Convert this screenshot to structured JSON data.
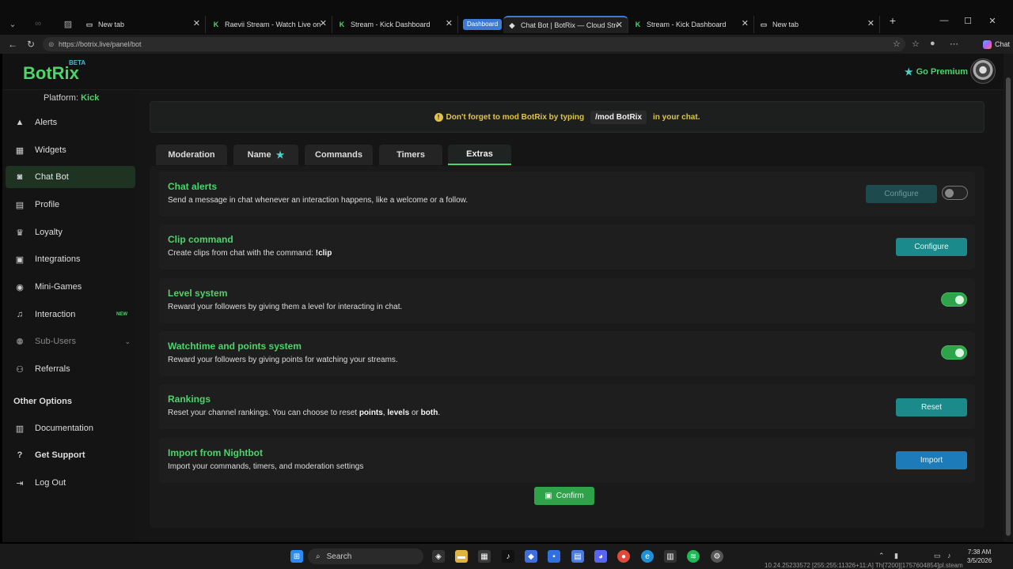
{
  "browser": {
    "tabs": [
      {
        "label": "New tab"
      },
      {
        "label": "Raevii Stream - Watch Live on Kick"
      },
      {
        "label": "Stream - Kick Dashboard"
      },
      {
        "label": "Chat Bot | BotRix — Cloud Streami"
      },
      {
        "label": "Stream - Kick Dashboard"
      },
      {
        "label": "New tab"
      }
    ],
    "group_label": "Dashboard",
    "url": "https://botrix.live/panel/bot",
    "chat_label": "Chat"
  },
  "header": {
    "logo": "BotRix",
    "beta": "BETA",
    "premium": "Go Premium"
  },
  "sidebar": {
    "platform_label": "Platform:",
    "platform_value": "Kick",
    "items": [
      {
        "label": "Alerts",
        "icon": "warning-icon"
      },
      {
        "label": "Widgets",
        "icon": "grid-icon"
      },
      {
        "label": "Chat Bot",
        "icon": "robot-icon"
      },
      {
        "label": "Profile",
        "icon": "id-card-icon"
      },
      {
        "label": "Loyalty",
        "icon": "trophy-icon"
      },
      {
        "label": "Integrations",
        "icon": "puzzle-icon"
      },
      {
        "label": "Mini-Games",
        "icon": "gamepad-icon"
      },
      {
        "label": "Interaction",
        "icon": "music-icon",
        "badge": "NEW"
      },
      {
        "label": "Sub-Users",
        "icon": "users-icon"
      },
      {
        "label": "Referrals",
        "icon": "user-group-icon"
      }
    ],
    "other_options": "Other Options",
    "other_items": [
      {
        "label": "Documentation",
        "icon": "book-icon"
      },
      {
        "label": "Get Support",
        "icon": "question-icon"
      },
      {
        "label": "Log Out",
        "icon": "logout-icon"
      }
    ]
  },
  "banner": {
    "before": "Don't forget to mod BotRix by typing",
    "command": "/mod BotRix",
    "after": "in your chat."
  },
  "tabs": [
    {
      "label": "Moderation"
    },
    {
      "label": "Name"
    },
    {
      "label": "Commands"
    },
    {
      "label": "Timers"
    },
    {
      "label": "Extras"
    }
  ],
  "features": [
    {
      "title": "Chat alerts",
      "desc": "Send a message in chat whenever an interaction happens, like a welcome or a follow.",
      "button": "Configure",
      "toggle": "off"
    },
    {
      "title": "Clip command",
      "desc_pre": "Create clips from chat with the command:",
      "desc_bold": "!clip",
      "button": "Configure"
    },
    {
      "title": "Level system",
      "desc": "Reward your followers by giving them a level for interacting in chat.",
      "toggle": "on"
    },
    {
      "title": "Watchtime and points system",
      "desc": "Reward your followers by giving points for watching your streams.",
      "toggle": "on"
    },
    {
      "title": "Rankings",
      "desc_pre": "Reset your channel rankings. You can choose to reset",
      "b1": "points",
      "sep1": ",",
      "b2": "levels",
      "sep2": "or",
      "b3": "both",
      "end": ".",
      "button": "Reset"
    },
    {
      "title": "Import from Nightbot",
      "desc": "Import your commands, timers, and moderation settings",
      "button": "Import"
    }
  ],
  "confirm": "Confirm",
  "taskbar": {
    "search": "Search",
    "time": "7:38 AM",
    "date": "3/5/2026",
    "status": "10.24.25233572 [255:255:11326+11:A] Th[7200][1757604854]pl.steam"
  }
}
